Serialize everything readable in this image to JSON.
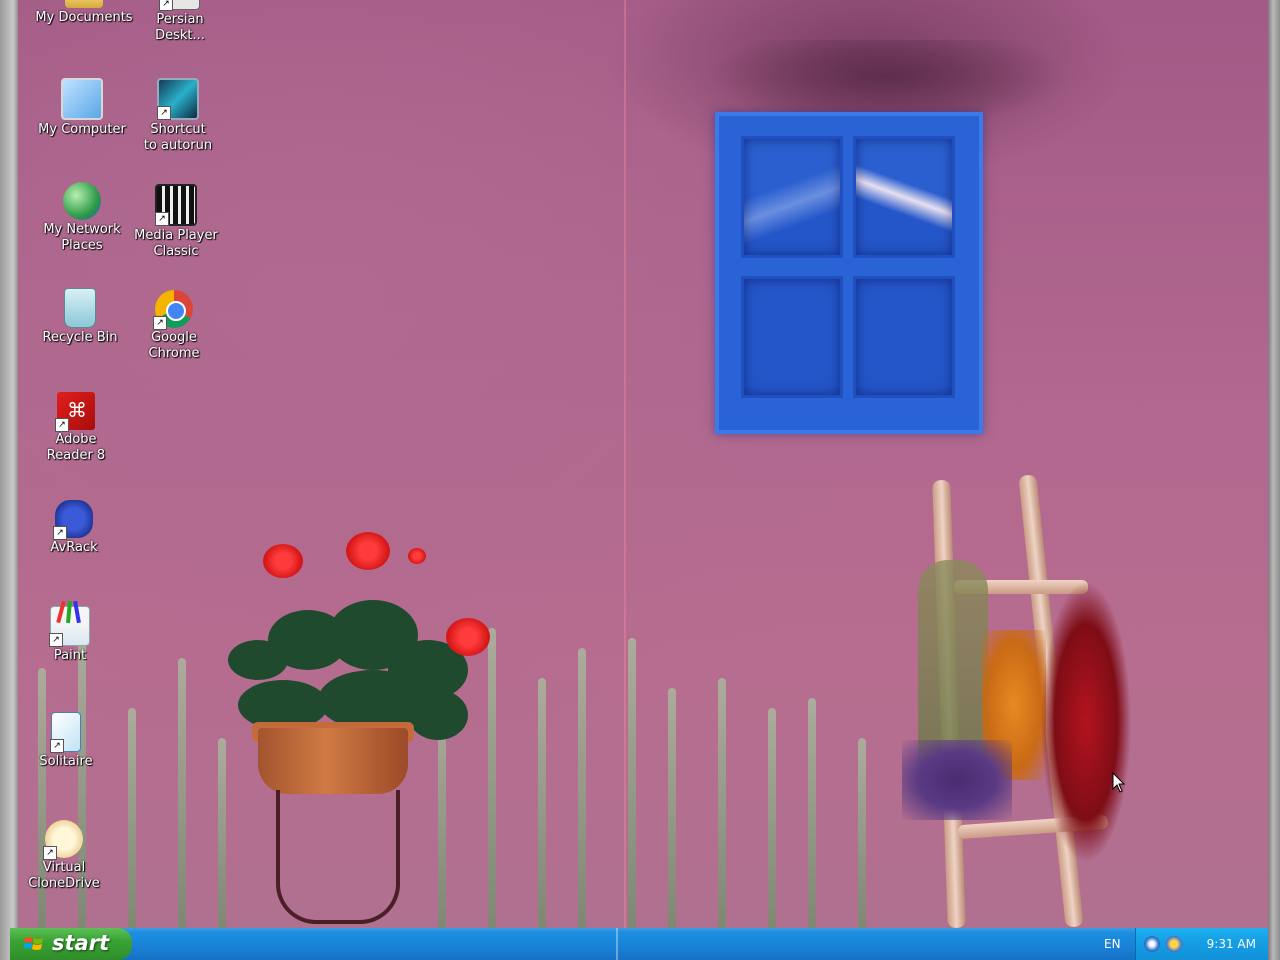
{
  "desktop": {
    "icons": [
      {
        "label": "My Documents",
        "icon": "folder-documents-icon",
        "shortcut": false
      },
      {
        "label": "Persian Deskt...",
        "icon": "persian-desktop-icon",
        "shortcut": true
      },
      {
        "label": "My Computer",
        "icon": "computer-icon",
        "shortcut": false
      },
      {
        "label": "Shortcut to autorun",
        "icon": "autorun-icon",
        "shortcut": true
      },
      {
        "label": "My Network Places",
        "icon": "network-globe-icon",
        "shortcut": false
      },
      {
        "label": "Media Player Classic",
        "icon": "media-player-icon",
        "shortcut": true
      },
      {
        "label": "Recycle Bin",
        "icon": "recycle-bin-icon",
        "shortcut": false
      },
      {
        "label": "Google Chrome",
        "icon": "chrome-icon",
        "shortcut": true
      },
      {
        "label": "Adobe Reader 8",
        "icon": "adobe-reader-icon",
        "shortcut": true
      },
      {
        "label": "AvRack",
        "icon": "avrack-icon",
        "shortcut": true
      },
      {
        "label": "Paint",
        "icon": "paint-icon",
        "shortcut": true
      },
      {
        "label": "Solitaire",
        "icon": "solitaire-icon",
        "shortcut": true
      },
      {
        "label": "Virtual CloneDrive",
        "icon": "clonedrive-sheep-icon",
        "shortcut": true
      }
    ]
  },
  "taskbar": {
    "start_label": "start",
    "language": "EN",
    "clock": "9:31 AM"
  },
  "colors": {
    "taskbar": "#1a80d6",
    "start_button": "#3aa335",
    "wall": "#b2688f",
    "window": "#2a63d6"
  }
}
